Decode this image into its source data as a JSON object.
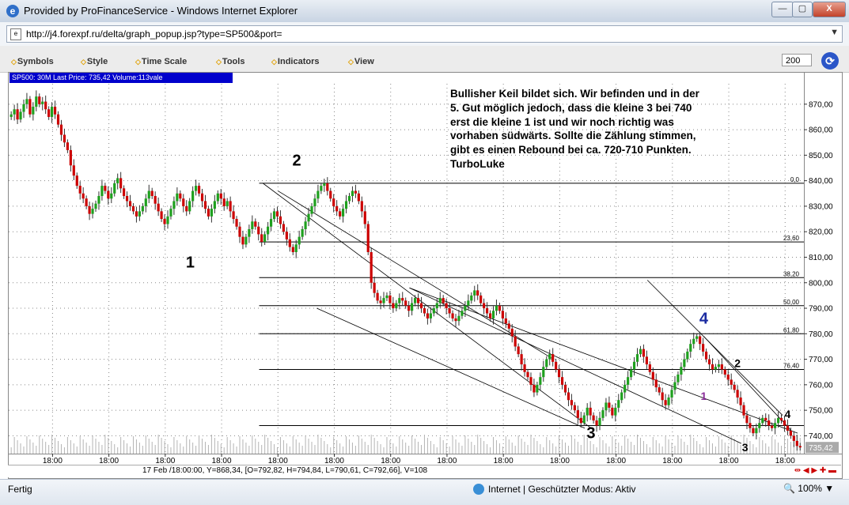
{
  "window": {
    "title": "Provided by ProFinanceService - Windows Internet Explorer",
    "min_label": "—",
    "max_label": "▢",
    "close_label": "X"
  },
  "address": {
    "url": "http://j4.forexpf.ru/delta/graph_popup.jsp?type=SP500&port="
  },
  "toolbar": {
    "items": [
      "Symbols",
      "Style",
      "Time Scale",
      "Tools",
      "Indicators",
      "View"
    ],
    "bars_value": "200"
  },
  "chart_info": "SP500: 30M Last Price: 735,42 Volume:113vale",
  "annotation_lines": [
    "Bullisher Keil bildet sich. Wir befinden und in der",
    "5. Gut möglich jedoch, dass die kleine 3 bei 740",
    "erst die kleine 1 ist und wir noch richtig was",
    "vorhaben südwärts. Sollte die Zählung stimmen,",
    "gibt es einen Rebound bei ca. 720-710 Punkten.",
    "TurboLuke"
  ],
  "wave_labels": [
    {
      "text": "1",
      "x": 14.5,
      "y": 806,
      "color": "#000000",
      "size": "large"
    },
    {
      "text": "2",
      "x": 23,
      "y": 846,
      "color": "#000000",
      "size": "large"
    },
    {
      "text": "3",
      "x": 46.5,
      "y": 739,
      "color": "#000000",
      "size": "large"
    },
    {
      "text": "4",
      "x": 55.5,
      "y": 784,
      "color": "#1a2aa0",
      "size": "large"
    },
    {
      "text": "1",
      "x": 55.5,
      "y": 754,
      "color": "#8b2f9a",
      "size": "small"
    },
    {
      "text": "2",
      "x": 58.2,
      "y": 767,
      "color": "#000000",
      "size": "small"
    },
    {
      "text": "3",
      "x": 58.8,
      "y": 734,
      "color": "#000000",
      "size": "small"
    },
    {
      "text": "4",
      "x": 62.2,
      "y": 747,
      "color": "#000000",
      "size": "small"
    }
  ],
  "chart_data": {
    "type": "candlestick",
    "symbol": "SP500",
    "timeframe": "30M",
    "ylim": [
      733,
      878
    ],
    "xlim": [
      0,
      63.5
    ],
    "y_ticks": [
      740,
      750,
      760,
      770,
      780,
      790,
      800,
      810,
      820,
      830,
      840,
      850,
      860,
      870
    ],
    "y_tick_labels": [
      "740,00",
      "750,00",
      "760,00",
      "770,00",
      "780,00",
      "790,00",
      "800,00",
      "810,00",
      "820,00",
      "830,00",
      "840,00",
      "850,00",
      "860,00",
      "870,00"
    ],
    "x_tick_positions": [
      3.5,
      8,
      12.5,
      17,
      21.5,
      26,
      30.5,
      35,
      39.5,
      44,
      48.5,
      53,
      57.5,
      62
    ],
    "x_tick_labels": [
      "18:00",
      "18:00",
      "18:00",
      "18:00",
      "18:00",
      "18:00",
      "18:00",
      "18:00",
      "18:00",
      "18:00",
      "18:00",
      "18:00",
      "18:00",
      "18:00"
    ],
    "last_price_label": "735,42",
    "last_price": 735.42,
    "fib_levels": [
      {
        "label": "0,0",
        "value": 839
      },
      {
        "label": "23,60",
        "value": 816
      },
      {
        "label": "38,20",
        "value": 802
      },
      {
        "label": "50,00",
        "value": 791
      },
      {
        "label": "61,80",
        "value": 780
      },
      {
        "label": "76,40",
        "value": 766
      },
      {
        "label": "",
        "value": 744
      }
    ],
    "trend_lines": [
      {
        "x1": 20.3,
        "y1": 839,
        "x2": 46.5,
        "y2": 743
      },
      {
        "x1": 24.6,
        "y1": 790,
        "x2": 46.0,
        "y2": 743
      },
      {
        "x1": 21.5,
        "y1": 836,
        "x2": 43.5,
        "y2": 770
      },
      {
        "x1": 32.0,
        "y1": 798,
        "x2": 63.0,
        "y2": 741
      },
      {
        "x1": 32.0,
        "y1": 798,
        "x2": 58.5,
        "y2": 737
      },
      {
        "x1": 51.0,
        "y1": 801,
        "x2": 61.8,
        "y2": 748
      },
      {
        "x1": 55.5,
        "y1": 779,
        "x2": 62.5,
        "y2": 742
      }
    ],
    "candle_up_color": "#1ea01e",
    "candle_down_color": "#cc0000",
    "volume_color": "#b4b4b4",
    "closes": [
      866,
      868,
      864,
      867,
      870,
      872,
      866,
      869,
      873,
      870,
      871,
      868,
      865,
      869,
      866,
      862,
      858,
      855,
      852,
      846,
      842,
      838,
      835,
      833,
      830,
      827,
      829,
      831,
      834,
      838,
      836,
      833,
      835,
      839,
      841,
      837,
      834,
      832,
      830,
      828,
      826,
      828,
      830,
      833,
      836,
      834,
      831,
      828,
      825,
      823,
      826,
      829,
      832,
      835,
      833,
      830,
      828,
      832,
      836,
      838,
      835,
      832,
      829,
      826,
      829,
      832,
      835,
      833,
      830,
      832,
      828,
      825,
      822,
      818,
      815,
      818,
      821,
      824,
      822,
      819,
      816,
      819,
      822,
      825,
      828,
      826,
      823,
      820,
      817,
      814,
      812,
      815,
      818,
      821,
      824,
      827,
      830,
      833,
      836,
      838,
      839,
      836,
      833,
      830,
      828,
      826,
      829,
      832,
      834,
      836,
      835,
      832,
      828,
      823,
      812,
      800,
      796,
      793,
      792,
      794,
      795,
      792,
      790,
      792,
      794,
      793,
      791,
      789,
      792,
      794,
      792,
      790,
      788,
      786,
      788,
      790,
      792,
      794,
      792,
      790,
      788,
      786,
      785,
      787,
      789,
      791,
      793,
      795,
      797,
      795,
      792,
      790,
      788,
      786,
      789,
      791,
      789,
      786,
      784,
      782,
      779,
      775,
      772,
      768,
      765,
      763,
      760,
      757,
      760,
      763,
      767,
      770,
      772,
      769,
      766,
      763,
      760,
      757,
      754,
      752,
      750,
      747,
      745,
      748,
      751,
      748,
      746,
      744,
      747,
      750,
      753,
      751,
      748,
      751,
      754,
      757,
      760,
      763,
      766,
      769,
      772,
      774,
      771,
      768,
      765,
      762,
      759,
      757,
      754,
      752,
      755,
      758,
      761,
      764,
      767,
      770,
      773,
      776,
      778,
      779,
      776,
      773,
      770,
      768,
      766,
      767,
      768,
      766,
      764,
      762,
      760,
      758,
      755,
      752,
      748,
      745,
      743,
      741,
      743,
      745,
      747,
      746,
      744,
      743,
      745,
      747,
      746,
      744,
      742,
      740,
      738,
      736,
      735.42
    ]
  }
}
